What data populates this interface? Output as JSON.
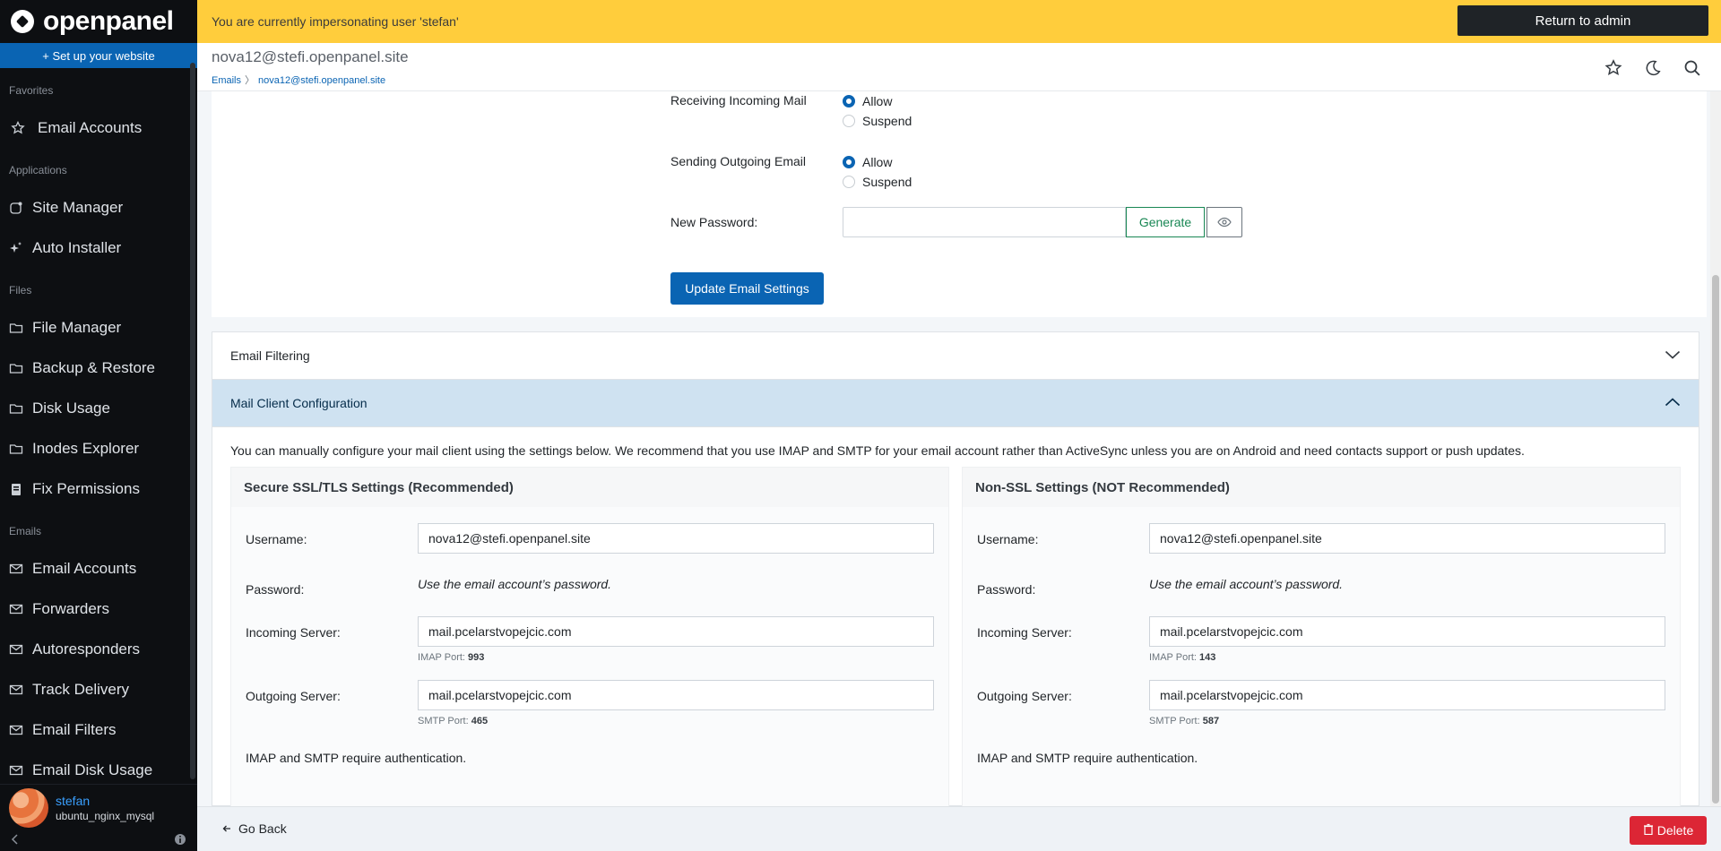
{
  "brand": {
    "name": "openpanel",
    "setup_label": "+ Set up your website"
  },
  "sidebar": {
    "sections": [
      {
        "heading": "Favorites",
        "items": [
          {
            "label": "Email Accounts",
            "icon": "star-icon"
          }
        ]
      },
      {
        "heading": "Applications",
        "items": [
          {
            "label": "Site Manager",
            "icon": "app-icon"
          },
          {
            "label": "Auto Installer",
            "icon": "sparkle-icon"
          }
        ]
      },
      {
        "heading": "Files",
        "items": [
          {
            "label": "File Manager",
            "icon": "folder-icon"
          },
          {
            "label": "Backup & Restore",
            "icon": "folder-icon"
          },
          {
            "label": "Disk Usage",
            "icon": "folder-icon"
          },
          {
            "label": "Inodes Explorer",
            "icon": "folder-icon"
          },
          {
            "label": "Fix Permissions",
            "icon": "clipboard-icon"
          }
        ]
      },
      {
        "heading": "Emails",
        "items": [
          {
            "label": "Email Accounts",
            "icon": "mail-icon"
          },
          {
            "label": "Forwarders",
            "icon": "mail-icon"
          },
          {
            "label": "Autoresponders",
            "icon": "mail-icon"
          },
          {
            "label": "Track Delivery",
            "icon": "mail-icon"
          },
          {
            "label": "Email Filters",
            "icon": "mail-icon"
          },
          {
            "label": "Email Disk Usage",
            "icon": "mail-icon"
          }
        ]
      }
    ],
    "user": {
      "name": "stefan",
      "host": "ubuntu_nginx_mysql"
    }
  },
  "banner": {
    "text": "You are currently impersonating user 'stefan'",
    "return_label": "Return to admin",
    "color": "#ffcd3c"
  },
  "header": {
    "title": "nova12@stefi.openpanel.site",
    "breadcrumb": {
      "root": "Emails",
      "sep": "〉",
      "current": "nova12@stefi.openpanel.site"
    }
  },
  "settings": {
    "incoming": {
      "label": "Receiving Incoming Mail",
      "allow": "Allow",
      "suspend": "Suspend"
    },
    "outgoing": {
      "label": "Sending Outgoing Email",
      "allow": "Allow",
      "suspend": "Suspend"
    },
    "password": {
      "label": "New Password:",
      "value": "",
      "generate_label": "Generate"
    },
    "update_label": "Update Email Settings"
  },
  "accordion": {
    "filtering_title": "Email Filtering",
    "client_title": "Mail Client Configuration",
    "intro": "You can manually configure your mail client using the settings below. We recommend that you use IMAP and SMTP for your email account rather than ActiveSync unless you are on Android and need contacts support or push updates.",
    "labels": {
      "username": "Username:",
      "password": "Password:",
      "incoming": "Incoming Server:",
      "outgoing": "Outgoing Server:"
    },
    "password_text": "Use the email account’s password.",
    "ssl": {
      "title": "Secure SSL/TLS Settings (Recommended)",
      "username": "nova12@stefi.openpanel.site",
      "incoming": "mail.pcelarstvopejcic.com",
      "imap_label": "IMAP Port:",
      "imap_port": "993",
      "outgoing": "mail.pcelarstvopejcic.com",
      "smtp_label": "SMTP Port:",
      "smtp_port": "465",
      "note": "IMAP and SMTP require authentication."
    },
    "nonssl": {
      "title": "Non-SSL Settings (NOT Recommended)",
      "username": "nova12@stefi.openpanel.site",
      "incoming": "mail.pcelarstvopejcic.com",
      "imap_label": "IMAP Port:",
      "imap_port": "143",
      "outgoing": "mail.pcelarstvopejcic.com",
      "smtp_label": "SMTP Port:",
      "smtp_port": "587",
      "note": "IMAP and SMTP require authentication."
    }
  },
  "footer": {
    "back_label": "Go Back",
    "delete_label": "Delete"
  }
}
